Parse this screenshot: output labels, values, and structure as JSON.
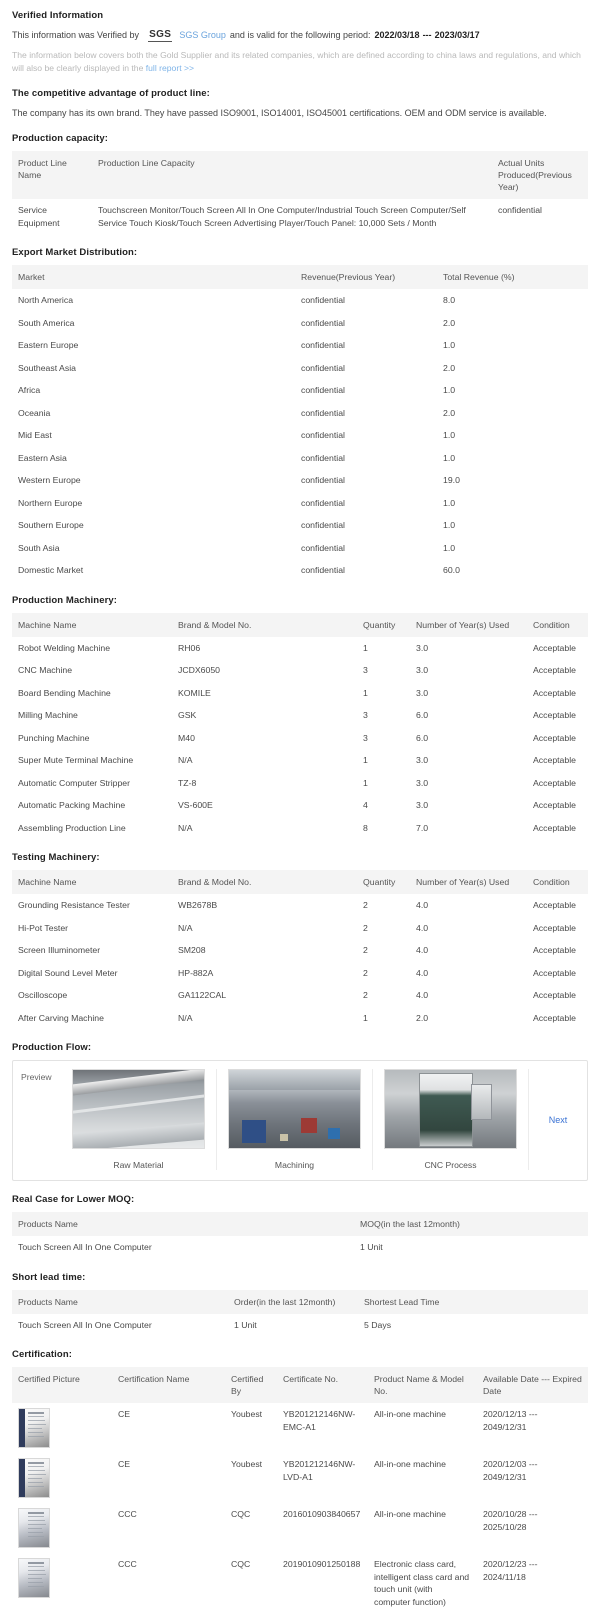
{
  "verified": {
    "title": "Verified Information",
    "line_prefix": "This information was Verified by",
    "badge": "SGS",
    "verifier_link": "SGS Group",
    "line_mid": "and is valid for the following period:",
    "period_start": "2022/03/18",
    "period_sep": "---",
    "period_end": "2023/03/17",
    "disclaimer_part1": "The information below covers both the Gold Supplier and its related companies, which are defined according to china laws and regulations, and which will also be clearly displayed in the",
    "disclaimer_link": "full report >>"
  },
  "advantage": {
    "title": "The competitive advantage of product line:",
    "text": "The company has its own brand. They have passed ISO9001, ISO14001, ISO45001 certifications. OEM and ODM service is available."
  },
  "production_capacity": {
    "title": "Production capacity:",
    "headers": [
      "Product Line Name",
      "Production Line Capacity",
      "Actual Units Produced(Previous Year)"
    ],
    "rows": [
      [
        "Service Equipment",
        "Touchscreen Monitor/Touch Screen All In One Computer/Industrial Touch Screen Computer/Self Service Touch Kiosk/Touch Screen Advertising Player/Touch Panel: 10,000 Sets / Month",
        "confidential"
      ]
    ]
  },
  "export_market": {
    "title": "Export Market Distribution:",
    "headers": [
      "Market",
      "Revenue(Previous Year)",
      "Total Revenue (%)"
    ],
    "rows": [
      [
        "North America",
        "confidential",
        "8.0"
      ],
      [
        "South America",
        "confidential",
        "2.0"
      ],
      [
        "Eastern Europe",
        "confidential",
        "1.0"
      ],
      [
        "Southeast Asia",
        "confidential",
        "2.0"
      ],
      [
        "Africa",
        "confidential",
        "1.0"
      ],
      [
        "Oceania",
        "confidential",
        "2.0"
      ],
      [
        "Mid East",
        "confidential",
        "1.0"
      ],
      [
        "Eastern Asia",
        "confidential",
        "1.0"
      ],
      [
        "Western Europe",
        "confidential",
        "19.0"
      ],
      [
        "Northern Europe",
        "confidential",
        "1.0"
      ],
      [
        "Southern Europe",
        "confidential",
        "1.0"
      ],
      [
        "South Asia",
        "confidential",
        "1.0"
      ],
      [
        "Domestic Market",
        "confidential",
        "60.0"
      ]
    ]
  },
  "production_machinery": {
    "title": "Production Machinery:",
    "headers": [
      "Machine Name",
      "Brand & Model No.",
      "Quantity",
      "Number of Year(s) Used",
      "Condition"
    ],
    "rows": [
      [
        "Robot Welding Machine",
        "RH06",
        "1",
        "3.0",
        "Acceptable"
      ],
      [
        "CNC Machine",
        "JCDX6050",
        "3",
        "3.0",
        "Acceptable"
      ],
      [
        "Board Bending Machine",
        "KOMILE",
        "1",
        "3.0",
        "Acceptable"
      ],
      [
        "Milling Machine",
        "GSK",
        "3",
        "6.0",
        "Acceptable"
      ],
      [
        "Punching Machine",
        "M40",
        "3",
        "6.0",
        "Acceptable"
      ],
      [
        "Super Mute Terminal Machine",
        "N/A",
        "1",
        "3.0",
        "Acceptable"
      ],
      [
        "Automatic Computer Stripper",
        "TZ-8",
        "1",
        "3.0",
        "Acceptable"
      ],
      [
        "Automatic Packing Machine",
        "VS-600E",
        "4",
        "3.0",
        "Acceptable"
      ],
      [
        "Assembling Production Line",
        "N/A",
        "8",
        "7.0",
        "Acceptable"
      ]
    ]
  },
  "testing_machinery": {
    "title": "Testing Machinery:",
    "headers": [
      "Machine Name",
      "Brand & Model No.",
      "Quantity",
      "Number of Year(s) Used",
      "Condition"
    ],
    "rows": [
      [
        "Grounding Resistance Tester",
        "WB2678B",
        "2",
        "4.0",
        "Acceptable"
      ],
      [
        "Hi-Pot Tester",
        "N/A",
        "2",
        "4.0",
        "Acceptable"
      ],
      [
        "Screen Illuminometer",
        "SM208",
        "2",
        "4.0",
        "Acceptable"
      ],
      [
        "Digital Sound Level Meter",
        "HP-882A",
        "2",
        "4.0",
        "Acceptable"
      ],
      [
        "Oscilloscope",
        "GA1122CAL",
        "2",
        "4.0",
        "Acceptable"
      ],
      [
        "After Carving Machine",
        "N/A",
        "1",
        "2.0",
        "Acceptable"
      ]
    ]
  },
  "production_flow": {
    "title": "Production Flow:",
    "preview_label": "Preview",
    "next_label": "Next",
    "items": [
      {
        "caption": "Raw Material",
        "image": "raw-material-photo"
      },
      {
        "caption": "Machining",
        "image": "machining-photo"
      },
      {
        "caption": "CNC Process",
        "image": "cnc-process-photo"
      }
    ]
  },
  "real_case_moq": {
    "title": "Real Case for Lower MOQ:",
    "headers": [
      "Products Name",
      "MOQ(in the last 12month)"
    ],
    "rows": [
      [
        "Touch Screen All In One Computer",
        "1 Unit"
      ]
    ]
  },
  "short_lead_time": {
    "title": "Short lead time:",
    "headers": [
      "Products Name",
      "Order(in the last 12month)",
      "Shortest Lead Time"
    ],
    "rows": [
      [
        "Touch Screen All In One Computer",
        "1 Unit",
        "5 Days"
      ]
    ]
  },
  "certification": {
    "title": "Certification:",
    "headers": [
      "Certified Picture",
      "Certification Name",
      "Certified By",
      "Certificate No.",
      "Product Name & Model No.",
      "Available Date --- Expired Date"
    ],
    "rows": [
      {
        "picture": "certificate-thumbnail-ce-emc",
        "style": "banded",
        "name": "CE",
        "by": "Youbest",
        "cert_no": "YB201212146NW-EMC-A1",
        "product": "All-in-one machine",
        "dates": "2020/12/13 --- 2049/12/31"
      },
      {
        "picture": "certificate-thumbnail-ce-lvd",
        "style": "banded",
        "name": "CE",
        "by": "Youbest",
        "cert_no": "YB201212146NW-LVD-A1",
        "product": "All-in-one machine",
        "dates": "2020/12/03 --- 2049/12/31"
      },
      {
        "picture": "certificate-thumbnail-ccc-1",
        "style": "plain",
        "name": "CCC",
        "by": "CQC",
        "cert_no": "2016010903840657",
        "product": "All-in-one machine",
        "dates": "2020/10/28 --- 2025/10/28"
      },
      {
        "picture": "certificate-thumbnail-ccc-2",
        "style": "plain",
        "name": "CCC",
        "by": "CQC",
        "cert_no": "2019010901250188",
        "product": "Electronic class card, intelligent class card and touch unit (with computer function)",
        "dates": "2020/12/23 --- 2024/11/18"
      }
    ]
  },
  "colors": {
    "link": "#4a90d9",
    "next_link": "#3b73d4",
    "header_bg": "#f4f4f4",
    "text": "#4a4a4a",
    "muted": "#b9b9b9"
  }
}
